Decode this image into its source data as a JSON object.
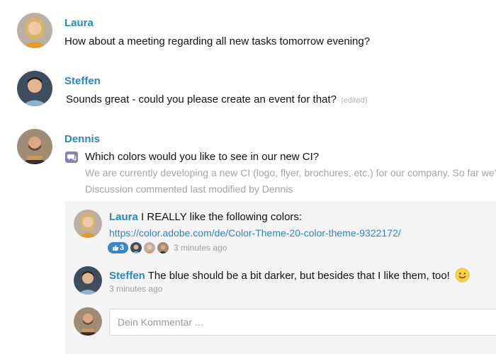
{
  "messages": [
    {
      "author": "Laura",
      "text": "How about a meeting regarding all new tasks tomorrow evening?"
    },
    {
      "author": "Steffen",
      "text": "Sounds great - could you please create an event for that?",
      "edited": "(edited)"
    },
    {
      "author": "Dennis"
    }
  ],
  "discussion": {
    "icon": "discussion-icon",
    "title": "Which colors would you like to see in our new CI?",
    "preview": "We are currently developing a new CI (logo, flyer, brochures, etc.) for our company. So far we've",
    "meta": "Discussion commented last modified by Dennis"
  },
  "comments": [
    {
      "author": "Laura",
      "text": "I REALLY like the following colors:",
      "link": "https://color.adobe.com/de/Color-Theme-20-color-theme-9322172/",
      "likes": "3",
      "time": "3 minutes ago"
    },
    {
      "author": "Steffen",
      "text": "The blue should be a bit darker, but besides that I like them, too!",
      "emoji": "smiley-emoji",
      "time": "3 minutes ago"
    }
  ],
  "comment_input": {
    "placeholder": "Dein Kommentar ..."
  },
  "colors": {
    "accent": "#2a86c8",
    "like_badge": "#3b85d0",
    "thread_bg": "#f4f4f4",
    "discussion_icon": "#8e7fb8"
  }
}
